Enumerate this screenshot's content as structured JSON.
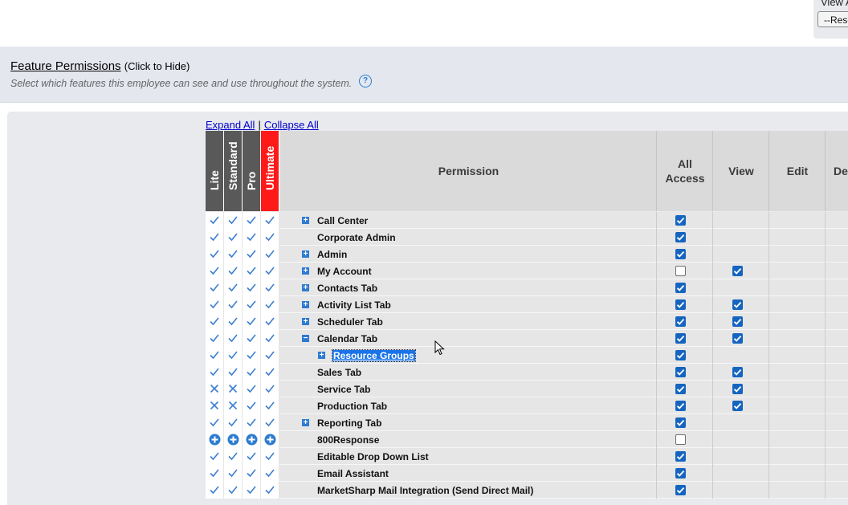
{
  "view_box": {
    "label": "View A",
    "select_value": "--Reso"
  },
  "section": {
    "title": "Feature Permissions",
    "hide_hint": "(Click to Hide)",
    "subtitle": "Select which features this employee can see and use throughout the system.",
    "help_icon": "question-circle-icon"
  },
  "links": {
    "expand_all": "Expand All",
    "separator": "|",
    "collapse_all": "Collapse All"
  },
  "tiers": [
    "Lite",
    "Standard",
    "Pro",
    "Ultimate"
  ],
  "tier_colors": {
    "default": "#595959",
    "ultimate": "#ff1a1a"
  },
  "columns": {
    "permission": "Permission",
    "all_access_line1": "All",
    "all_access_line2": "Access",
    "view": "View",
    "edit": "Edit",
    "delete": "De"
  },
  "icons": {
    "included": "check-icon",
    "excluded": "x-icon",
    "addon": "plus-circle-icon",
    "expand": "expand-plus-icon",
    "collapse": "collapse-minus-icon"
  },
  "rows": [
    {
      "label": "Call Center",
      "tiers": [
        "check",
        "check",
        "check",
        "check"
      ],
      "toggle": "expand",
      "indent": 0,
      "all_access": true,
      "view": null
    },
    {
      "label": "Corporate Admin",
      "tiers": [
        "check",
        "check",
        "check",
        "check"
      ],
      "toggle": null,
      "indent": 0,
      "all_access": true,
      "view": null
    },
    {
      "label": "Admin",
      "tiers": [
        "check",
        "check",
        "check",
        "check"
      ],
      "toggle": "expand",
      "indent": 0,
      "all_access": true,
      "view": null
    },
    {
      "label": "My Account",
      "tiers": [
        "check",
        "check",
        "check",
        "check"
      ],
      "toggle": "expand",
      "indent": 0,
      "all_access": false,
      "view": true
    },
    {
      "label": "Contacts Tab",
      "tiers": [
        "check",
        "check",
        "check",
        "check"
      ],
      "toggle": "expand",
      "indent": 0,
      "all_access": true,
      "view": null
    },
    {
      "label": "Activity List Tab",
      "tiers": [
        "check",
        "check",
        "check",
        "check"
      ],
      "toggle": "expand",
      "indent": 0,
      "all_access": true,
      "view": true
    },
    {
      "label": "Scheduler Tab",
      "tiers": [
        "check",
        "check",
        "check",
        "check"
      ],
      "toggle": "expand",
      "indent": 0,
      "all_access": true,
      "view": true
    },
    {
      "label": "Calendar Tab",
      "tiers": [
        "check",
        "check",
        "check",
        "check"
      ],
      "toggle": "collapse",
      "indent": 0,
      "all_access": true,
      "view": true
    },
    {
      "label": "Resource Groups",
      "tiers": [
        "check",
        "check",
        "check",
        "check"
      ],
      "toggle": "expand",
      "indent": 1,
      "all_access": true,
      "view": null,
      "selected": true
    },
    {
      "label": "Sales Tab",
      "tiers": [
        "check",
        "check",
        "check",
        "check"
      ],
      "toggle": null,
      "indent": 0,
      "all_access": true,
      "view": true
    },
    {
      "label": "Service Tab",
      "tiers": [
        "x",
        "x",
        "check",
        "check"
      ],
      "toggle": null,
      "indent": 0,
      "all_access": true,
      "view": true
    },
    {
      "label": "Production Tab",
      "tiers": [
        "x",
        "x",
        "check",
        "check"
      ],
      "toggle": null,
      "indent": 0,
      "all_access": true,
      "view": true
    },
    {
      "label": "Reporting Tab",
      "tiers": [
        "check",
        "check",
        "check",
        "check"
      ],
      "toggle": "expand",
      "indent": 0,
      "all_access": true,
      "view": null
    },
    {
      "label": "800Response",
      "tiers": [
        "plus",
        "plus",
        "plus",
        "plus"
      ],
      "toggle": null,
      "indent": 0,
      "all_access": false,
      "view": null
    },
    {
      "label": "Editable Drop Down List",
      "tiers": [
        "check",
        "check",
        "check",
        "check"
      ],
      "toggle": null,
      "indent": 0,
      "all_access": true,
      "view": null
    },
    {
      "label": "Email Assistant",
      "tiers": [
        "check",
        "check",
        "check",
        "check"
      ],
      "toggle": null,
      "indent": 0,
      "all_access": true,
      "view": null
    },
    {
      "label": "MarketSharp Mail Integration (Send Direct Mail)",
      "tiers": [
        "check",
        "check",
        "check",
        "check"
      ],
      "toggle": null,
      "indent": 0,
      "all_access": true,
      "view": null
    }
  ]
}
